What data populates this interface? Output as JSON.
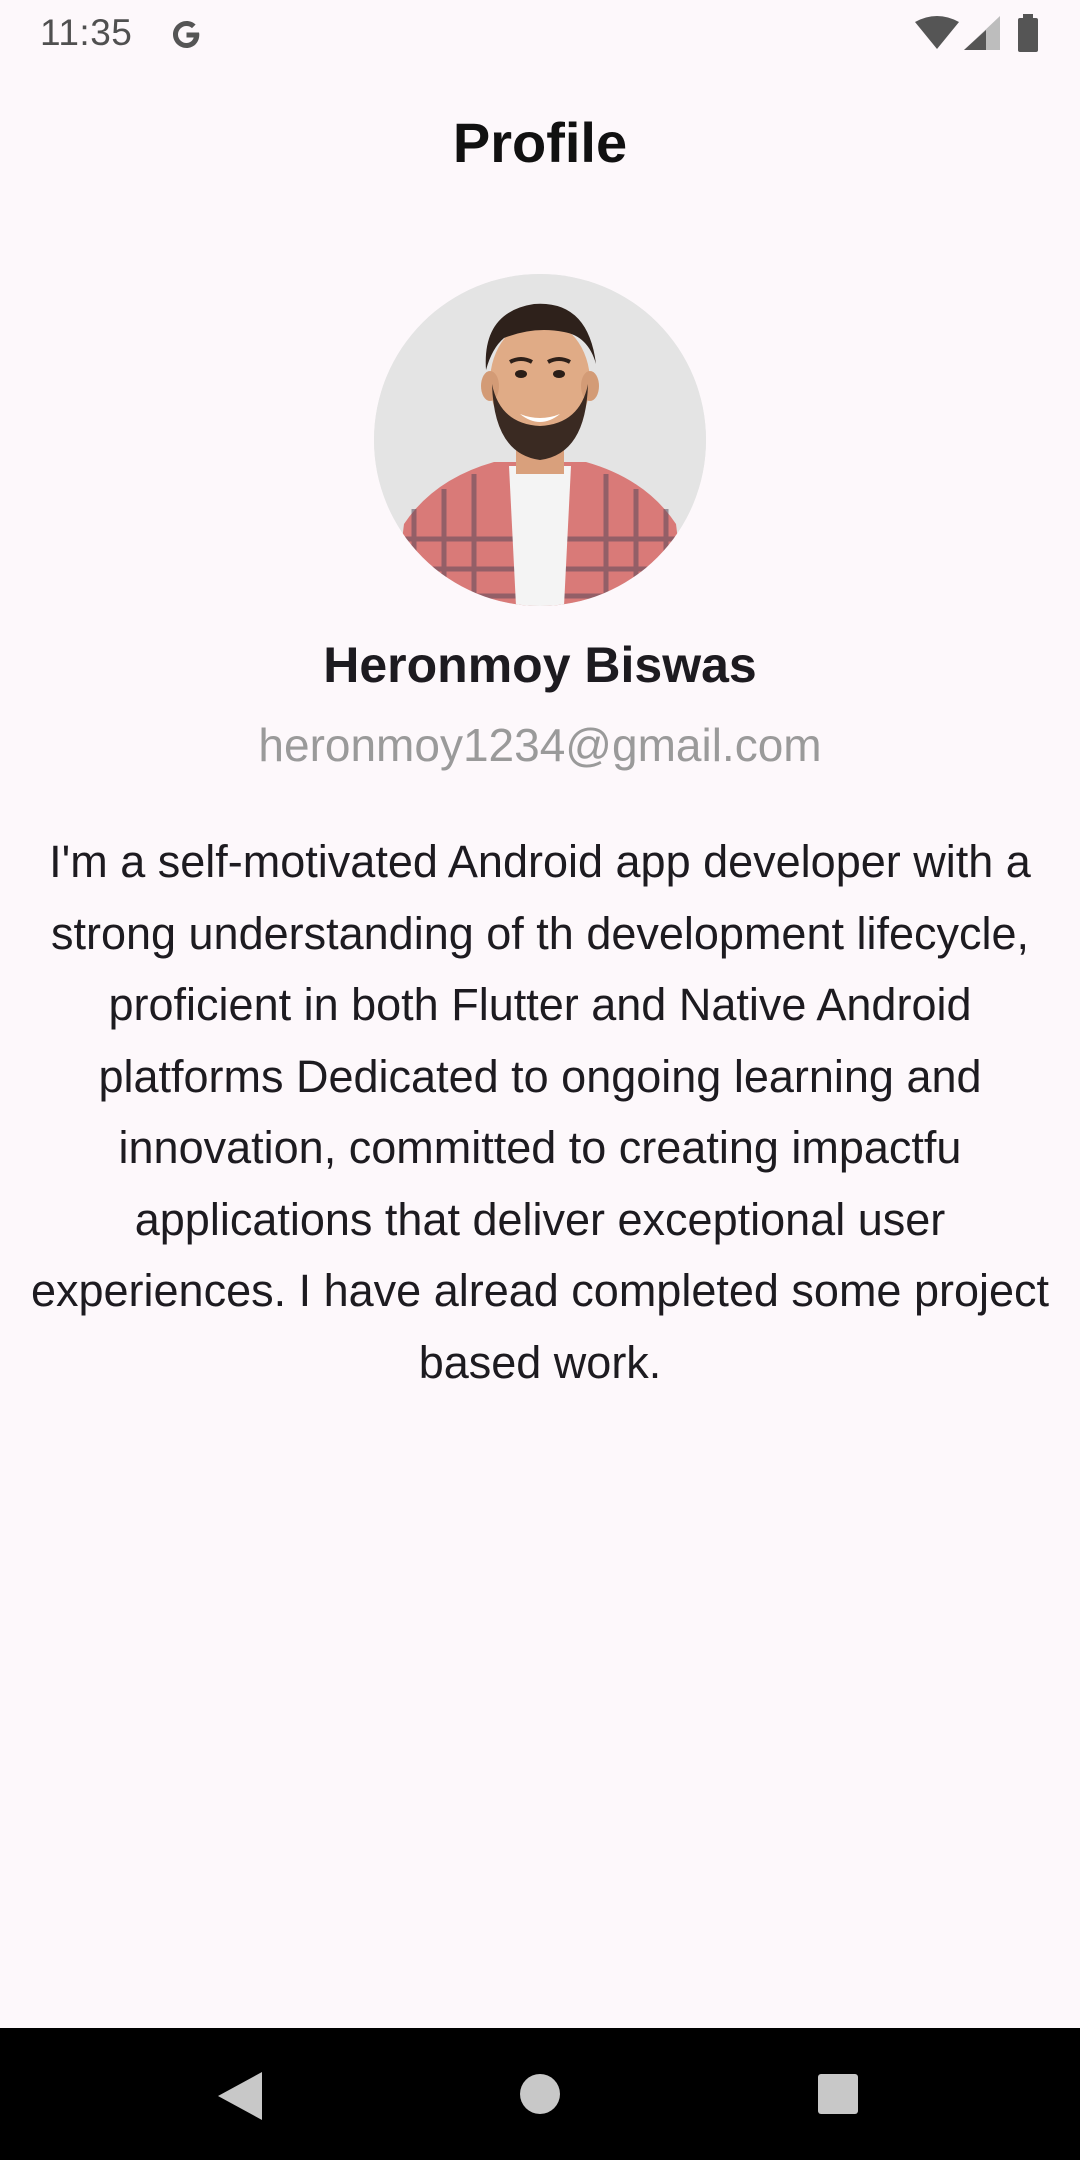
{
  "status_bar": {
    "time": "11:35",
    "icons": [
      "google-icon",
      "wifi-icon",
      "cellular-signal-icon",
      "battery-icon"
    ]
  },
  "app_bar": {
    "title": "Profile"
  },
  "profile": {
    "avatar": "profile-photo",
    "name": "Heronmoy Biswas",
    "email": "heronmoy1234@gmail.com",
    "bio": "I'm a self-motivated Android app developer with a strong understanding of th development lifecycle, proficient in both Flutter and Native Android platforms Dedicated to ongoing learning and innovation, committed to creating impactfu applications that deliver exceptional user experiences. I have alread completed some project based work."
  },
  "navigation_bar": {
    "buttons": [
      "back-icon",
      "home-icon",
      "recents-icon"
    ]
  },
  "colors": {
    "background": "#fdf8fb",
    "title_text": "#111111",
    "body_text": "#1d1b20",
    "email_text": "#9a9a9a",
    "nav_bar": "#000000"
  }
}
